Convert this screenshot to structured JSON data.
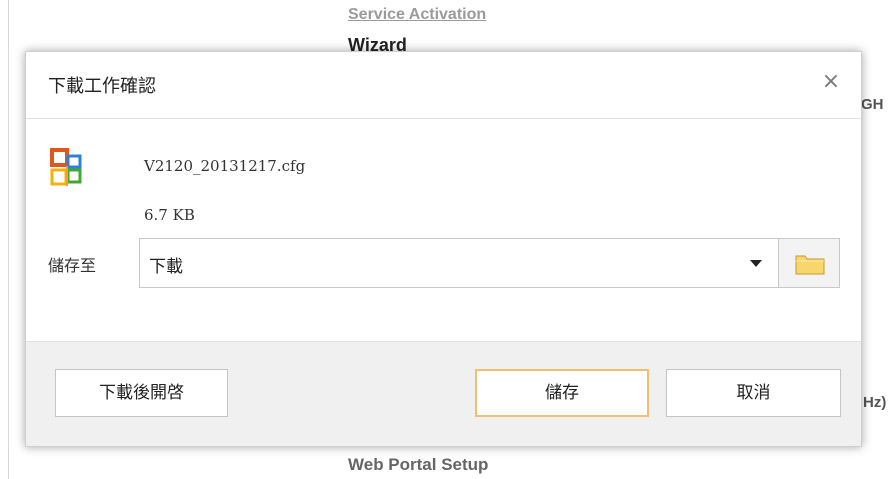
{
  "background": {
    "link_text": "Service Activation",
    "wizard_text": "Wizard",
    "right_fragment_top": "GH",
    "right_fragment_bottom": "Hz)",
    "portal_text": "Web Portal Setup"
  },
  "dialog": {
    "title": "下載工作確認",
    "close_glyph": "×",
    "file": {
      "icon": "office-file-icon",
      "name": "V2120_20131217.cfg",
      "size": "6.7 KB"
    },
    "save_to": {
      "label": "儲存至",
      "selected": "下載",
      "browse_icon": "folder-icon"
    },
    "buttons": {
      "open_after_download": "下載後開啓",
      "save": "儲存",
      "cancel": "取消"
    }
  },
  "colors": {
    "save_button_border": "#f5bd72",
    "footer_background": "#f0f0f0"
  }
}
